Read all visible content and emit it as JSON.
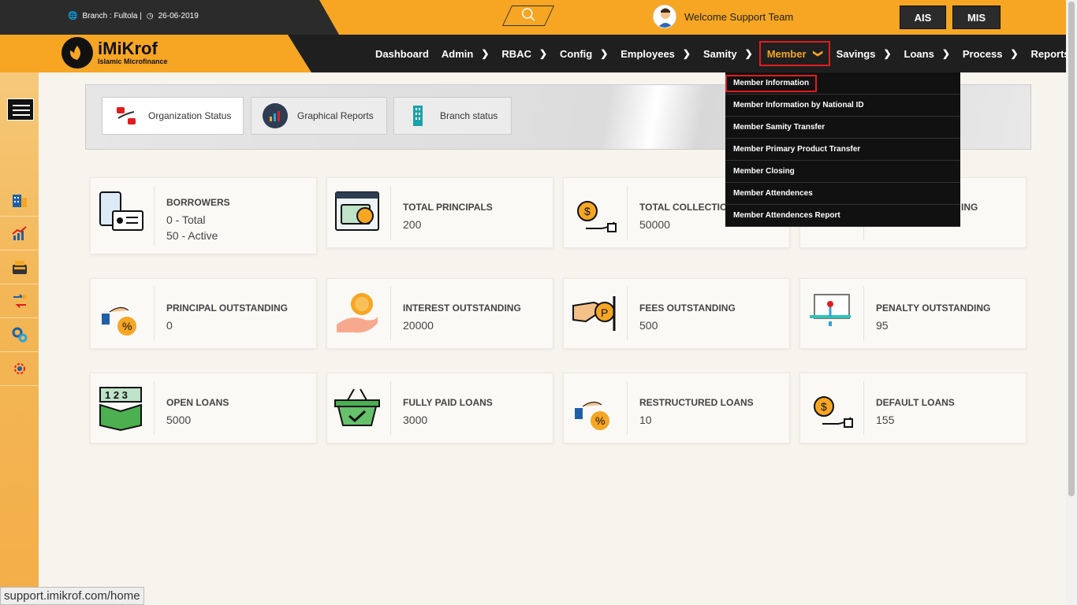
{
  "topbar": {
    "branch": "Branch : Fultola |",
    "date": "26-06-2019",
    "welcome": "Welcome Support Team",
    "ais_label": "AIS",
    "mis_label": "MIS"
  },
  "logo": {
    "name": "iMiKrof",
    "tagline": "Islamic Microfinance"
  },
  "nav": {
    "items": [
      {
        "label": "Dashboard"
      },
      {
        "label": "Admin"
      },
      {
        "label": "RBAC"
      },
      {
        "label": "Config"
      },
      {
        "label": "Employees"
      },
      {
        "label": "Samity"
      },
      {
        "label": "Member"
      },
      {
        "label": "Savings"
      },
      {
        "label": "Loans"
      },
      {
        "label": "Process"
      },
      {
        "label": "Reports"
      }
    ]
  },
  "member_menu": [
    "Member Information",
    "Member Information by National ID",
    "Member Samity Transfer",
    "Member Primary Product Transfer",
    "Member Closing",
    "Member Attendences",
    "Member Attendences Report"
  ],
  "tabs": [
    {
      "label": "Organization Status"
    },
    {
      "label": "Graphical Reports"
    },
    {
      "label": "Branch status"
    }
  ],
  "cards": {
    "borrowers": {
      "title": "BORROWERS",
      "line1": "0 - Total",
      "line2": "50 - Active"
    },
    "total_principals": {
      "title": "TOTAL PRINCIPALS",
      "value": "200"
    },
    "total_collection": {
      "title": "TOTAL COLLECTIO",
      "value": "50000"
    },
    "fourth": {
      "title": "ING"
    },
    "principal_outstanding": {
      "title": "PRINCIPAL OUTSTANDING",
      "value": "0"
    },
    "interest_outstanding": {
      "title": "INTEREST OUTSTANDING",
      "value": "20000"
    },
    "fees_outstanding": {
      "title": "FEES OUTSTANDING",
      "value": "500"
    },
    "penalty_outstanding": {
      "title": "PENALTY OUTSTANDING",
      "value": "95"
    },
    "open_loans": {
      "title": "OPEN LOANS",
      "value": "5000"
    },
    "fully_paid_loans": {
      "title": "FULLY PAID LOANS",
      "value": "3000"
    },
    "restructured_loans": {
      "title": "RESTRUCTURED LOANS",
      "value": "10"
    },
    "default_loans": {
      "title": "DEFAULT LOANS",
      "value": "155"
    }
  },
  "icons": {
    "open_loans_digits": "1 2 3"
  },
  "statusbar": "support.imikrof.com/home",
  "colors": {
    "accent": "#f6a623",
    "dark": "#1f1f1f",
    "highlight": "#e31c1c"
  }
}
